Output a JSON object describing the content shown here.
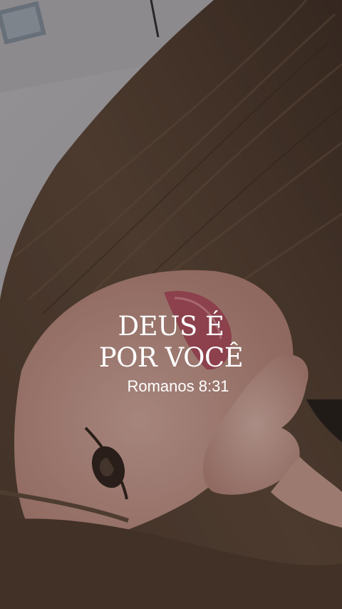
{
  "verse": {
    "line1": "DEUS É",
    "line2": "POR VOCÊ",
    "reference": "Romanos 8:31"
  },
  "colors": {
    "text": "#ffffff",
    "hair": "#5a4436",
    "skin": "#d9a99b",
    "lips": "#c25a6a",
    "wall": "#d8d4d7"
  }
}
